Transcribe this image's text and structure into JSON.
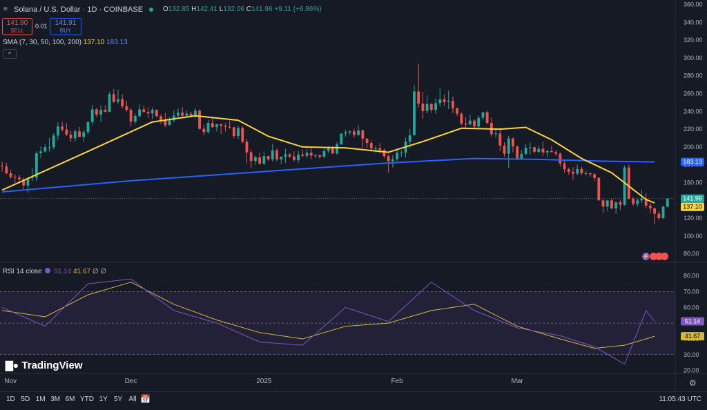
{
  "header": {
    "symbol_title": "Solana / U.S. Dollar · 1D · COINBASE",
    "ohlc": {
      "o_label": "O",
      "o": "132.85",
      "h_label": "H",
      "h": "142.41",
      "l_label": "L",
      "l": "132.06",
      "c_label": "C",
      "c": "141.96",
      "change": "+9.11 (+6.86%)"
    },
    "sell": {
      "price": "141.90",
      "label": "SELL"
    },
    "buy": {
      "price": "141.91",
      "label": "BUY"
    },
    "spread": "0.01"
  },
  "sma": {
    "label": "SMA (7, 30, 50, 100, 200)",
    "v1": "137.10",
    "v2": "183.13"
  },
  "collapse_glyph": "^",
  "rsi": {
    "label": "RSI 14 close",
    "value": "51.14",
    "ma": "41.67",
    "extra1": "∅",
    "extra2": "∅"
  },
  "price_axis": {
    "ticks": [
      "360.00",
      "340.00",
      "320.00",
      "300.00",
      "280.00",
      "260.00",
      "240.00",
      "220.00",
      "200.00",
      "180.00",
      "160.00",
      "140.00",
      "120.00",
      "100.00",
      "80.00"
    ],
    "badges": {
      "last": "141.96",
      "sma_short": "137.10",
      "sma_long": "183.13"
    }
  },
  "rsi_axis": {
    "ticks": [
      "80.00",
      "70.00",
      "60.00",
      "40.00",
      "30.00",
      "20.00"
    ],
    "badges": {
      "rsi": "51.14",
      "rsi_ma": "41.67"
    }
  },
  "time_axis": [
    "Nov",
    "Dec",
    "2025",
    "Feb",
    "Mar"
  ],
  "bottom": {
    "ranges": [
      "1D",
      "5D",
      "1M",
      "3M",
      "6M",
      "YTD",
      "1Y",
      "5Y",
      "All"
    ],
    "clock": "11:05:43 UTC"
  },
  "logo": "TradingView",
  "colors": {
    "up": "#26a69a",
    "down": "#ef5350",
    "sma_short": "#fbd53b",
    "sma_long": "#2962ff",
    "rsi": "#7e57c2",
    "rsi_ma": "#d4b83a",
    "background": "#161a25"
  },
  "chart_data": {
    "type": "candlestick",
    "title": "Solana / U.S. Dollar · 1D · COINBASE",
    "y_range": [
      72,
      365
    ],
    "days": 152,
    "candles": [
      [
        178.6,
        183.5,
        172.2,
        177.9
      ],
      [
        177.9,
        182.2,
        169.3,
        170.4
      ],
      [
        170.4,
        174.5,
        164.2,
        166.2
      ],
      [
        166.2,
        169.5,
        159.2,
        165.6
      ],
      [
        165.6,
        168.6,
        158.8,
        163.7
      ],
      [
        163.7,
        165.5,
        152.6,
        156.7
      ],
      [
        156.7,
        165.8,
        148.4,
        165.0
      ],
      [
        165.0,
        176.0,
        161.6,
        165.6
      ],
      [
        165.6,
        195.0,
        162.0,
        192.9
      ],
      [
        192.9,
        200.7,
        187.6,
        195.0
      ],
      [
        195.0,
        202.9,
        193.5,
        199.8
      ],
      [
        199.8,
        210.1,
        194.8,
        199.8
      ],
      [
        199.8,
        215.3,
        197.2,
        212.8
      ],
      [
        212.8,
        227.6,
        207.9,
        222.8
      ],
      [
        222.8,
        228.1,
        217.3,
        219.4
      ],
      [
        219.4,
        226.7,
        212.5,
        213.8
      ],
      [
        213.8,
        218.4,
        205.8,
        209.7
      ],
      [
        209.7,
        219.7,
        206.3,
        217.6
      ],
      [
        217.6,
        222.4,
        210.8,
        211.2
      ],
      [
        211.2,
        219.7,
        205.6,
        216.7
      ],
      [
        216.7,
        228.3,
        213.8,
        228.0
      ],
      [
        228.0,
        247.3,
        224.4,
        242.2
      ],
      [
        242.2,
        243.8,
        233.3,
        236.4
      ],
      [
        236.4,
        246.7,
        228.0,
        241.6
      ],
      [
        241.6,
        246.8,
        238.9,
        239.5
      ],
      [
        239.5,
        262.0,
        239.1,
        259.2
      ],
      [
        259.2,
        265.1,
        249.3,
        250.7
      ],
      [
        250.7,
        264.1,
        248.3,
        253.5
      ],
      [
        253.5,
        259.3,
        243.4,
        245.6
      ],
      [
        245.6,
        251.7,
        239.6,
        241.6
      ],
      [
        241.6,
        244.0,
        222.9,
        228.5
      ],
      [
        228.5,
        237.7,
        225.6,
        234.8
      ],
      [
        234.8,
        247.7,
        232.9,
        242.2
      ],
      [
        242.2,
        246.2,
        239.1,
        239.3
      ],
      [
        239.3,
        244.4,
        232.7,
        237.7
      ],
      [
        237.7,
        244.5,
        231.2,
        241.7
      ],
      [
        241.7,
        242.2,
        233.6,
        234.5
      ],
      [
        234.5,
        236.9,
        225.5,
        229.3
      ],
      [
        229.3,
        238.1,
        222.2,
        224.4
      ],
      [
        224.4,
        233.7,
        224.3,
        229.9
      ],
      [
        229.9,
        241.1,
        227.7,
        235.1
      ],
      [
        235.1,
        243.4,
        233.0,
        238.5
      ],
      [
        238.5,
        244.6,
        233.1,
        235.1
      ],
      [
        235.1,
        240.5,
        232.6,
        237.4
      ],
      [
        237.4,
        239.6,
        233.1,
        234.2
      ],
      [
        234.2,
        243.3,
        232.5,
        240.7
      ],
      [
        240.7,
        242.1,
        219.3,
        220.4
      ],
      [
        220.4,
        225.0,
        213.0,
        216.7
      ],
      [
        216.7,
        230.5,
        214.8,
        227.0
      ],
      [
        227.0,
        232.4,
        221.5,
        222.2
      ],
      [
        222.2,
        226.1,
        217.4,
        225.5
      ],
      [
        225.5,
        226.1,
        214.4,
        223.7
      ],
      [
        223.7,
        226.5,
        217.3,
        222.5
      ],
      [
        222.5,
        229.7,
        220.5,
        222.0
      ],
      [
        222.0,
        222.6,
        209.7,
        212.3
      ],
      [
        212.3,
        223.5,
        208.6,
        221.2
      ],
      [
        221.2,
        223.5,
        204.3,
        205.9
      ],
      [
        205.9,
        208.9,
        181.5,
        193.9
      ],
      [
        193.9,
        197.1,
        176.1,
        184.2
      ],
      [
        184.2,
        190.4,
        180.0,
        188.3
      ],
      [
        188.3,
        193.7,
        179.8,
        181.3
      ],
      [
        181.3,
        194.8,
        179.5,
        189.7
      ],
      [
        189.7,
        190.2,
        184.1,
        186.0
      ],
      [
        186.0,
        203.3,
        183.8,
        196.2
      ],
      [
        196.2,
        198.6,
        183.6,
        185.9
      ],
      [
        185.9,
        189.3,
        180.7,
        189.1
      ],
      [
        189.1,
        197.9,
        182.0,
        191.6
      ],
      [
        191.6,
        193.1,
        187.5,
        189.3
      ],
      [
        189.3,
        195.1,
        183.6,
        185.2
      ],
      [
        185.2,
        195.7,
        182.0,
        191.4
      ],
      [
        191.4,
        196.9,
        188.3,
        190.0
      ],
      [
        190.0,
        197.8,
        187.4,
        193.4
      ],
      [
        193.4,
        199.1,
        186.4,
        190.3
      ],
      [
        190.3,
        192.0,
        187.3,
        190.7
      ],
      [
        190.7,
        191.2,
        186.6,
        189.0
      ],
      [
        189.0,
        198.6,
        187.8,
        195.3
      ],
      [
        195.3,
        200.9,
        193.6,
        199.3
      ],
      [
        199.3,
        201.4,
        192.1,
        192.7
      ],
      [
        192.7,
        205.7,
        190.9,
        202.8
      ],
      [
        202.8,
        215.2,
        202.7,
        215.0
      ],
      [
        215.0,
        219.2,
        211.4,
        216.4
      ],
      [
        216.4,
        219.1,
        213.2,
        217.4
      ],
      [
        217.4,
        220.6,
        210.2,
        213.4
      ],
      [
        213.4,
        224.4,
        212.9,
        218.5
      ],
      [
        218.5,
        219.5,
        198.6,
        209.4
      ],
      [
        209.4,
        209.4,
        198.5,
        204.5
      ],
      [
        204.5,
        207.4,
        194.8,
        198.4
      ],
      [
        198.4,
        201.4,
        193.5,
        198.5
      ],
      [
        198.5,
        204.2,
        192.8,
        196.5
      ],
      [
        196.5,
        198.2,
        187.4,
        189.6
      ],
      [
        189.6,
        191.9,
        171.0,
        184.0
      ],
      [
        184.0,
        191.0,
        177.0,
        186.2
      ],
      [
        186.2,
        198.6,
        184.2,
        193.5
      ],
      [
        193.5,
        196.8,
        188.5,
        193.6
      ],
      [
        193.6,
        210.4,
        188.3,
        205.9
      ],
      [
        205.9,
        220.2,
        198.5,
        213.2
      ],
      [
        213.2,
        269.6,
        212.7,
        262.3
      ],
      [
        262.3,
        293.7,
        244.1,
        248.6
      ],
      [
        248.6,
        262.0,
        231.6,
        240.3
      ],
      [
        240.3,
        257.9,
        237.4,
        248.2
      ],
      [
        248.2,
        249.3,
        238.1,
        241.6
      ],
      [
        241.6,
        254.6,
        237.0,
        249.2
      ],
      [
        249.2,
        265.8,
        245.3,
        253.4
      ],
      [
        253.4,
        259.0,
        245.9,
        250.3
      ],
      [
        250.3,
        263.3,
        242.6,
        251.6
      ],
      [
        251.6,
        256.5,
        237.8,
        243.7
      ],
      [
        243.7,
        244.0,
        234.6,
        237.3
      ],
      [
        237.3,
        238.9,
        224.5,
        226.3
      ],
      [
        226.3,
        233.6,
        220.3,
        225.3
      ],
      [
        225.3,
        236.6,
        224.1,
        229.6
      ],
      [
        229.6,
        231.4,
        221.3,
        223.0
      ],
      [
        223.0,
        235.1,
        220.3,
        232.8
      ],
      [
        232.8,
        239.5,
        230.4,
        238.9
      ],
      [
        238.9,
        240.5,
        225.3,
        226.9
      ],
      [
        226.9,
        233.0,
        211.4,
        214.4
      ],
      [
        214.4,
        219.5,
        210.5,
        215.1
      ],
      [
        215.1,
        221.3,
        195.5,
        201.5
      ],
      [
        201.5,
        205.1,
        189.0,
        192.4
      ],
      [
        192.4,
        212.6,
        176.7,
        209.5
      ],
      [
        209.5,
        210.7,
        194.0,
        200.6
      ],
      [
        200.6,
        201.4,
        185.3,
        186.9
      ],
      [
        186.9,
        196.6,
        185.4,
        192.1
      ],
      [
        192.1,
        203.4,
        191.1,
        199.1
      ],
      [
        199.1,
        204.9,
        191.1,
        199.6
      ],
      [
        199.6,
        200.2,
        192.6,
        194.6
      ],
      [
        194.6,
        201.3,
        192.6,
        197.9
      ],
      [
        197.9,
        206.0,
        189.8,
        193.8
      ],
      [
        193.8,
        196.9,
        188.8,
        195.3
      ],
      [
        195.3,
        201.3,
        194.2,
        194.1
      ],
      [
        194.1,
        196.8,
        190.0,
        192.4
      ],
      [
        192.4,
        193.6,
        178.0,
        181.5
      ],
      [
        181.5,
        184.6,
        171.2,
        175.0
      ],
      [
        175.0,
        176.8,
        168.8,
        172.1
      ],
      [
        172.1,
        177.2,
        163.2,
        170.0
      ],
      [
        170.0,
        180.3,
        168.2,
        175.2
      ],
      [
        175.2,
        177.6,
        168.3,
        170.3
      ],
      [
        170.3,
        173.4,
        167.9,
        170.4
      ],
      [
        170.4,
        171.3,
        166.6,
        169.3
      ],
      [
        169.3,
        170.3,
        161.6,
        165.2
      ],
      [
        165.2,
        165.9,
        140.0,
        140.0
      ],
      [
        140.0,
        142.0,
        126.0,
        133.0
      ],
      [
        133.0,
        140.0,
        128.0,
        140.0
      ],
      [
        140.0,
        142.0,
        130.0,
        131.0
      ],
      [
        131.0,
        138.0,
        125.0,
        138.0
      ],
      [
        138.0,
        140.0,
        129.0,
        135.0
      ],
      [
        135.0,
        179.0,
        134.0,
        177.0
      ],
      [
        177.0,
        180.0,
        141.0,
        142.0
      ],
      [
        142.0,
        144.0,
        134.0,
        136.0
      ],
      [
        136.0,
        142.0,
        133.0,
        140.0
      ],
      [
        140.0,
        152.0,
        137.0,
        142.0
      ],
      [
        142.0,
        148.0,
        131.0,
        134.0
      ],
      [
        134.0,
        137.0,
        125.0,
        131.0
      ],
      [
        131.0,
        132.0,
        113.0,
        125.0
      ],
      [
        125.0,
        128.0,
        118.0,
        120.0
      ],
      [
        120.0,
        134.0,
        119.0,
        132.85
      ],
      [
        132.85,
        142.41,
        132.06,
        141.96
      ]
    ],
    "sma_short_endpoints": {
      "start": 151.5,
      "end": 137.1
    },
    "sma_long_endpoints": {
      "start": 149.5,
      "end": 183.13
    },
    "sma_short_curve": [
      [
        0,
        151.5
      ],
      [
        20,
        195
      ],
      [
        35,
        228
      ],
      [
        45,
        235
      ],
      [
        55,
        230
      ],
      [
        62,
        212
      ],
      [
        70,
        200
      ],
      [
        80,
        199
      ],
      [
        90,
        194
      ],
      [
        98,
        206
      ],
      [
        107,
        221
      ],
      [
        116,
        220
      ],
      [
        122,
        222
      ],
      [
        128,
        208
      ],
      [
        135,
        187
      ],
      [
        142,
        171
      ],
      [
        150,
        141
      ],
      [
        152,
        137.1
      ]
    ],
    "sma_long_curve": [
      [
        0,
        149.5
      ],
      [
        30,
        162
      ],
      [
        60,
        172
      ],
      [
        90,
        182
      ],
      [
        110,
        187
      ],
      [
        125,
        186
      ],
      [
        140,
        184
      ],
      [
        152,
        183.13
      ]
    ],
    "rsi_curve": [
      [
        0,
        60
      ],
      [
        10,
        48
      ],
      [
        20,
        75
      ],
      [
        30,
        78
      ],
      [
        40,
        58
      ],
      [
        50,
        50
      ],
      [
        60,
        38
      ],
      [
        70,
        36
      ],
      [
        80,
        60
      ],
      [
        90,
        51
      ],
      [
        100,
        76
      ],
      [
        110,
        58
      ],
      [
        120,
        47
      ],
      [
        130,
        42
      ],
      [
        138,
        35
      ],
      [
        145,
        24
      ],
      [
        150,
        58
      ],
      [
        152,
        51.14
      ]
    ],
    "rsi_ma_curve": [
      [
        0,
        58
      ],
      [
        10,
        54
      ],
      [
        20,
        68
      ],
      [
        30,
        76
      ],
      [
        40,
        62
      ],
      [
        50,
        52
      ],
      [
        60,
        44
      ],
      [
        70,
        40
      ],
      [
        80,
        48
      ],
      [
        90,
        50
      ],
      [
        100,
        58
      ],
      [
        110,
        62
      ],
      [
        120,
        48
      ],
      [
        130,
        40
      ],
      [
        138,
        34
      ],
      [
        145,
        36
      ],
      [
        150,
        40
      ],
      [
        152,
        41.67
      ]
    ],
    "rsi_range": [
      15,
      86
    ],
    "rsi_bands": [
      30,
      70
    ],
    "time_ticks": [
      {
        "label": "Nov",
        "day": 0
      },
      {
        "label": "Dec",
        "day": 30
      },
      {
        "label": "2025",
        "day": 61
      },
      {
        "label": "Feb",
        "day": 92
      },
      {
        "label": "Mar",
        "day": 120
      }
    ]
  }
}
